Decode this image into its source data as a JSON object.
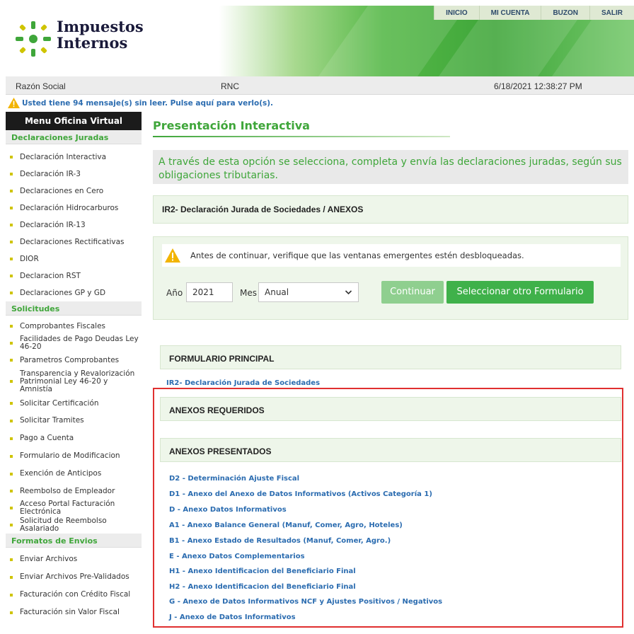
{
  "header": {
    "brand_line1": "Impuestos",
    "brand_line2": "Internos",
    "nav": [
      "INICIO",
      "MI CUENTA",
      "BUZON",
      "SALIR"
    ],
    "colors": {
      "accent": "#3fa63a",
      "link": "#2b6cb0",
      "highlight": "#e03030"
    }
  },
  "infobar": {
    "razon_social": "Razón Social",
    "rnc": "RNC",
    "datetime": "6/18/2021 12:38:27 PM"
  },
  "messages": {
    "icon": "warning-icon",
    "text": "Usted tiene 94 mensaje(s) sin leer. Pulse aquí para verlo(s)."
  },
  "sidebar": {
    "title": "Menu Oficina Virtual",
    "sections": [
      {
        "label": "Declaraciones Juradas",
        "items": [
          "Declaración Interactiva",
          "Declaración IR-3",
          "Declaraciones en Cero",
          "Declaración Hidrocarburos",
          "Declaración IR-13",
          "Declaraciones Rectificativas",
          "DIOR",
          "Declaracion RST",
          "Declaraciones GP y GD"
        ]
      },
      {
        "label": "Solicitudes",
        "items": [
          "Comprobantes Fiscales",
          "Facilidades de Pago Deudas Ley 46-20",
          "Parametros Comprobantes",
          "Transparencia y Revalorización Patrimonial Ley 46-20 y Amnistía",
          "Solicitar Certificación",
          "Solicitar Tramites",
          "Pago a Cuenta",
          "Formulario de Modificacion",
          "Exención de Anticipos",
          "Reembolso de Empleador",
          "Acceso Portal Facturación Electrónica",
          "Solicitud de Reembolso Asalariado"
        ]
      },
      {
        "label": "Formatos de Envios",
        "items": [
          "Enviar Archivos",
          "Enviar Archivos Pre-Validados",
          "Facturación con Crédito Fiscal",
          "Facturación sin Valor Fiscal"
        ]
      }
    ]
  },
  "main": {
    "title": "Presentación Interactiva",
    "description": "A través de esta opción se selecciona, completa y envía las declaraciones juradas, según sus obligaciones tributarias.",
    "form_name": "IR2- Declaración Jurada de Sociedades / ANEXOS",
    "alert": "Antes de continuar, verifique que las ventanas emergentes estén desbloqueadas.",
    "filters": {
      "year_label": "Año",
      "year_value": "2021",
      "month_label": "Mes",
      "month_value": "Anual",
      "continue_label": "Continuar",
      "other_form_label": "Seleccionar otro Formulario"
    },
    "formulario_principal": {
      "heading": "FORMULARIO PRINCIPAL",
      "link": "IR2- Declaración Jurada de Sociedades"
    },
    "anexos_requeridos": {
      "heading": "ANEXOS REQUERIDOS"
    },
    "anexos_presentados": {
      "heading": "ANEXOS PRESENTADOS",
      "links": [
        "D2 - Determinación Ajuste Fiscal",
        "D1 - Anexo del Anexo de Datos Informativos (Activos Categoría 1)",
        "D - Anexo Datos Informativos",
        "A1 - Anexo Balance General (Manuf, Comer, Agro, Hoteles)",
        "B1 - Anexo Estado de Resultados (Manuf, Comer, Agro.)",
        "E - Anexo Datos Complementarios",
        "H1 - Anexo Identificacion del Beneficiario Final",
        "H2 - Anexo Identificacion del Beneficiario Final",
        "G - Anexo de Datos Informativos NCF y Ajustes Positivos / Negativos",
        "J - Anexo de Datos Informativos"
      ]
    }
  }
}
